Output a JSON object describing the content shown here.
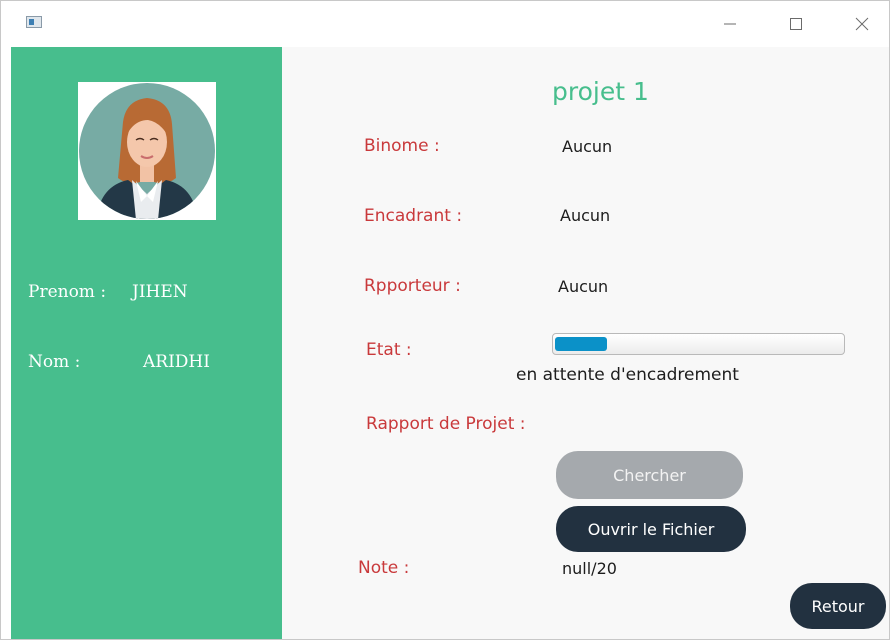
{
  "window": {
    "minimize_icon": "minimize-icon",
    "maximize_icon": "maximize-icon",
    "close_icon": "close-icon"
  },
  "sidebar": {
    "avatar_icon": "female-user-avatar",
    "prenom_label": "Prenom :",
    "prenom_value": "JIHEN",
    "nom_label": "Nom :",
    "nom_value": "ARIDHI"
  },
  "project": {
    "title": "projet 1",
    "binome_label": "Binome :",
    "binome_value": "Aucun",
    "encadrant_label": "Encadrant :",
    "encadrant_value": "Aucun",
    "rapporteur_label": "Rpporteur :",
    "rapporteur_value": "Aucun",
    "etat_label": "Etat :",
    "progress_fraction": 0.18,
    "etat_status": "en attente d'encadrement",
    "rapport_label": "Rapport de Projet :",
    "chercher_button": "Chercher",
    "ouvrir_button": "Ouvrir le Fichier",
    "note_label": "Note :",
    "note_value": "null/20",
    "retour_button": "Retour"
  },
  "colors": {
    "sidebar_green": "#47be8d",
    "label_red": "#c9393b",
    "dark_button": "#223140",
    "disabled_button": "#a5a9ad",
    "progress_blue": "#0b91c8"
  }
}
